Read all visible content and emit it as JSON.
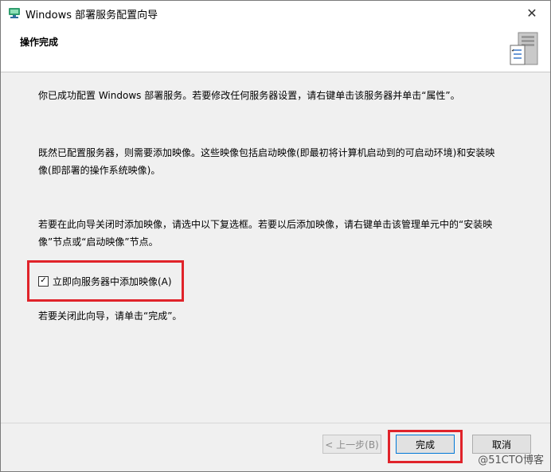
{
  "window": {
    "title": "Windows 部署服务配置向导",
    "close_glyph": "✕"
  },
  "header": {
    "title": "操作完成"
  },
  "content": {
    "para1": "你已成功配置 Windows 部署服务。若要修改任何服务器设置，请右键单击该服务器并单击“属性”。",
    "para2": "既然已配置服务器，则需要添加映像。这些映像包括启动映像(即最初将计算机启动到的可启动环境)和安装映像(即部署的操作系统映像)。",
    "para3": "若要在此向导关闭时添加映像，请选中以下复选框。若要以后添加映像，请右键单击该管理单元中的“安装映像”节点或“启动映像”节点。",
    "checkbox_label": "立即向服务器中添加映像(A)",
    "checkbox_checked": true,
    "para4": "若要关闭此向导，请单击“完成”。"
  },
  "buttons": {
    "back": "< 上一步(B)",
    "finish": "完成",
    "cancel": "取消"
  },
  "watermark": "@51CTO博客",
  "colors": {
    "highlight": "#e0232a",
    "focus": "#0078d7"
  },
  "icons": {
    "title": "deployment-services-icon",
    "header": "server-icon"
  }
}
